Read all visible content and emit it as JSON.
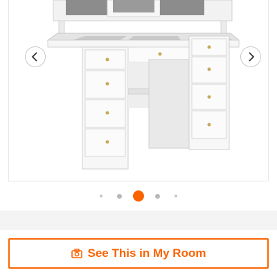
{
  "gallery": {
    "image_subject": "white vanity desk with drawers and lighted mirror",
    "prev_icon": "chevron-left-icon",
    "next_icon": "chevron-right-icon"
  },
  "pagination": {
    "count": 5,
    "active_index": 2
  },
  "cta": {
    "label": "See This in My Room",
    "icon": "camera-icon"
  },
  "colors": {
    "accent": "#f96302",
    "dot": "#c4c4c4",
    "band": "#f4f4f4"
  }
}
